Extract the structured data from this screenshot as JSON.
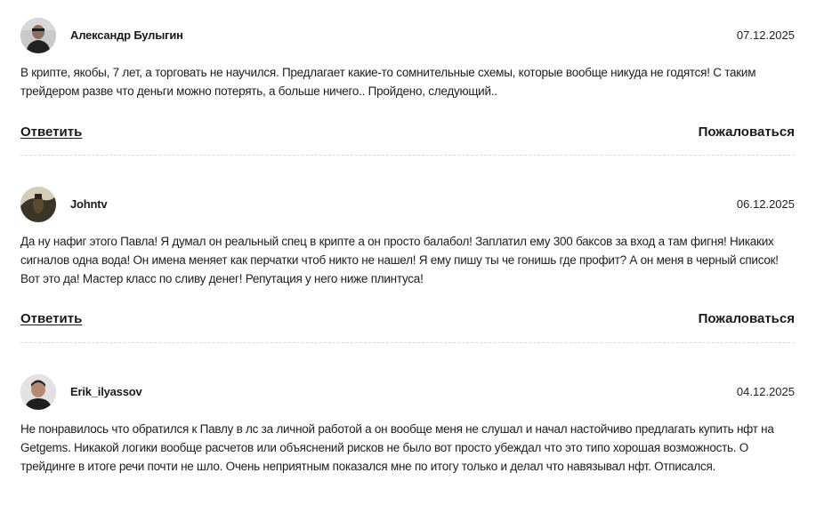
{
  "comments": [
    {
      "author": "Александр Булыгин",
      "date": "07.12.2025",
      "avatar_icon": "user-avatar-photo",
      "text": "В крипте, якобы, 7 лет, а торговать не научился. Предлагает какие-то сомнительные схемы, которые вообще никуда не годятся! С таким трейдером разве что деньги можно потерять, а больше ничего.. Пройдено, следующий..",
      "reply_label": "Ответить",
      "report_label": "Пожаловаться"
    },
    {
      "author": "Johntv",
      "date": "06.12.2025",
      "avatar_icon": "user-avatar-photo",
      "text": "Да ну нафиг этого Павла! Я думал он реальный спец в крипте а он просто балабол! Заплатил ему 300 баксов за вход а там фигня! Никаких сигналов одна вода! Он имена меняет как перчатки чтоб никто не нашел! Я ему пишу ты че гонишь где профит? А он меня в черный список! Вот это да! Мастер класс по сливу денег! Репутация у него ниже плинтуса!",
      "reply_label": "Ответить",
      "report_label": "Пожаловаться"
    },
    {
      "author": "Erik_ilyassov",
      "date": "04.12.2025",
      "avatar_icon": "user-avatar-photo",
      "text": "Не понравилось что обратился к Павлу в лс за личной работой а он вообще меня не слушал и начал настойчиво предлагать купить нфт на Getgems. Никакой логики вообще расчетов или объяснений рисков не было вот просто убеждал что это типо хорошая возможность. О трейдинге в итоге речи почти не шло. Очень неприятным показался мне по итогу только и делал что навязывал нфт. Отписался.",
      "reply_label": "Ответить",
      "report_label": "Пожаловаться"
    }
  ]
}
